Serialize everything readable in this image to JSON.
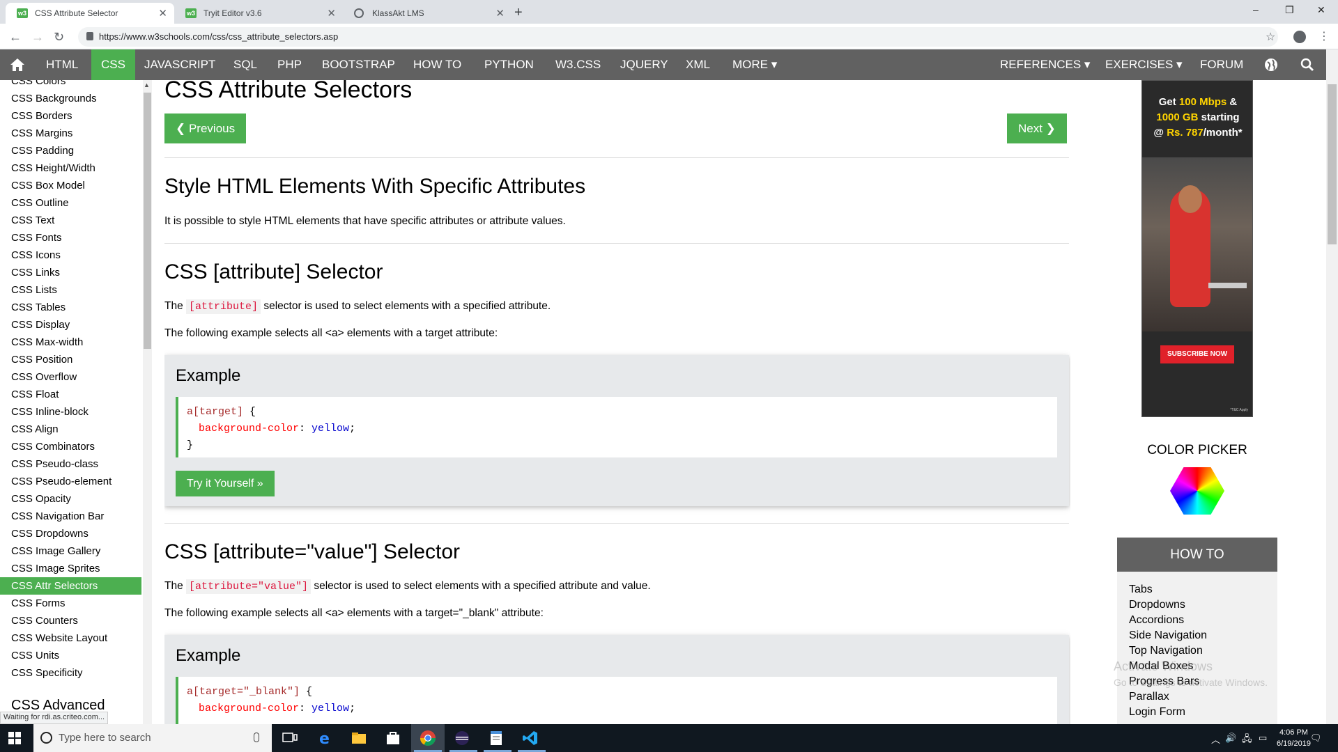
{
  "browser": {
    "tabs": [
      {
        "title": "CSS Attribute Selector",
        "active": true,
        "favicon": "w3schools-icon"
      },
      {
        "title": "Tryit Editor v3.6",
        "active": false,
        "favicon": "w3schools-icon"
      },
      {
        "title": "KlassAkt LMS",
        "active": false,
        "favicon": "globe-icon"
      }
    ],
    "new_tab": "+",
    "window_controls": [
      "–",
      "❐",
      "✕"
    ],
    "url": "https://www.w3schools.com/css/css_attribute_selectors.asp",
    "status_text": "Waiting for rdi.as.criteo.com..."
  },
  "topnav": {
    "items": [
      "HTML",
      "CSS",
      "JAVASCRIPT",
      "SQL",
      "PHP",
      "BOOTSTRAP",
      "HOW TO",
      "PYTHON",
      "W3.CSS",
      "JQUERY",
      "XML",
      "MORE ▾"
    ],
    "active": "CSS",
    "right_items": [
      "REFERENCES ▾",
      "EXERCISES ▾",
      "FORUM"
    ]
  },
  "sidebar": {
    "links": [
      "CSS Colors",
      "CSS Backgrounds",
      "CSS Borders",
      "CSS Margins",
      "CSS Padding",
      "CSS Height/Width",
      "CSS Box Model",
      "CSS Outline",
      "CSS Text",
      "CSS Fonts",
      "CSS Icons",
      "CSS Links",
      "CSS Lists",
      "CSS Tables",
      "CSS Display",
      "CSS Max-width",
      "CSS Position",
      "CSS Overflow",
      "CSS Float",
      "CSS Inline-block",
      "CSS Align",
      "CSS Combinators",
      "CSS Pseudo-class",
      "CSS Pseudo-element",
      "CSS Opacity",
      "CSS Navigation Bar",
      "CSS Dropdowns",
      "CSS Image Gallery",
      "CSS Image Sprites",
      "CSS Attr Selectors",
      "CSS Forms",
      "CSS Counters",
      "CSS Website Layout",
      "CSS Units",
      "CSS Specificity"
    ],
    "active": "CSS Attr Selectors",
    "section_heading": "CSS Advanced"
  },
  "main": {
    "title": "CSS Attribute Selectors",
    "prev_label": "❮ Previous",
    "next_label": "Next ❯",
    "section1": {
      "heading": "Style HTML Elements With Specific Attributes",
      "text": "It is possible to style HTML elements that have specific attributes or attribute values."
    },
    "section2": {
      "heading": "CSS [attribute] Selector",
      "text_before": "The ",
      "code": "[attribute]",
      "text_after": " selector is used to select elements with a specified attribute.",
      "text2": "The following example selects all <a> elements with a target attribute:",
      "example_title": "Example",
      "code_lines": {
        "selector": "a[target]",
        "open": " {",
        "prop": "background-color",
        "colon": ": ",
        "val": "yellow",
        "semi": ";",
        "close": "}"
      },
      "try_label": "Try it Yourself »"
    },
    "section3": {
      "heading": "CSS [attribute=\"value\"] Selector",
      "text_before": "The ",
      "code": "[attribute=\"value\"]",
      "text_after": " selector is used to select elements with a specified attribute and value.",
      "text2": "The following example selects all <a> elements with a target=\"_blank\" attribute:",
      "example_title": "Example",
      "code_lines": {
        "selector": "a[target=\"_blank\"]",
        "open": " {",
        "prop": "background-color",
        "colon": ": ",
        "val": "yellow",
        "semi": ";"
      }
    }
  },
  "ad": {
    "line1_a": "Get ",
    "line1_b": "100 Mbps",
    "line1_c": " &",
    "line2_a": "1000 GB",
    "line2_b": " starting",
    "line3_a": "@ ",
    "line3_b": "Rs. 787",
    "line3_c": "/month*",
    "cta": "SUBSCRIBE NOW",
    "tnc": "*T&C Apply"
  },
  "color_picker": {
    "title": "COLOR PICKER"
  },
  "howto": {
    "heading": "HOW TO",
    "links": [
      "Tabs",
      "Dropdowns",
      "Accordions",
      "Side Navigation",
      "Top Navigation",
      "Modal Boxes",
      "Progress Bars",
      "Parallax",
      "Login Form"
    ]
  },
  "watermark": {
    "line1": "Activate Windows",
    "line2": "Go to Settings to activate Windows."
  },
  "taskbar": {
    "search_placeholder": "Type here to search",
    "time": "4:06 PM",
    "date": "6/19/2019"
  },
  "colors": {
    "accent": "#4caf50",
    "nav": "#616161",
    "code_red": "crimson"
  }
}
